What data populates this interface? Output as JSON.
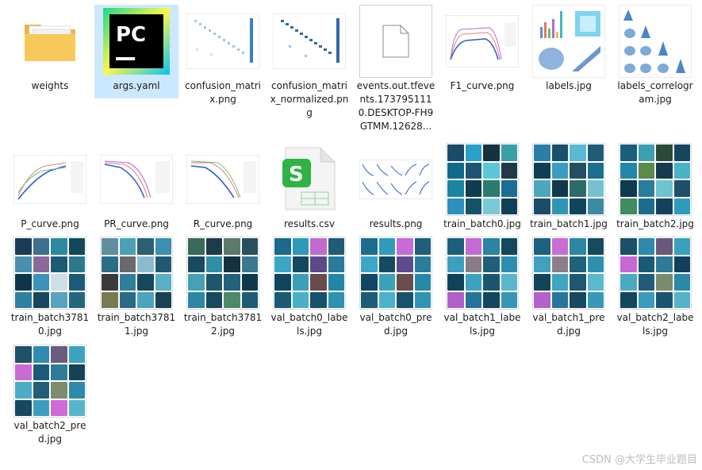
{
  "files": [
    {
      "name": "weights",
      "kind": "folder"
    },
    {
      "name": "args.yaml",
      "kind": "pycharm",
      "selected": true
    },
    {
      "name": "confusion_matrix.png",
      "kind": "matrix"
    },
    {
      "name": "confusion_matrix_normalized.png",
      "kind": "matrix"
    },
    {
      "name": "events.out.tfevents.1737951110.DESKTOP-FH9GTMM.12628...",
      "kind": "blank"
    },
    {
      "name": "F1_curve.png",
      "kind": "curve"
    },
    {
      "name": "labels.jpg",
      "kind": "labels"
    },
    {
      "name": "labels_correlogram.jpg",
      "kind": "correlogram"
    },
    {
      "name": "P_curve.png",
      "kind": "curve"
    },
    {
      "name": "PR_curve.png",
      "kind": "curve"
    },
    {
      "name": "R_curve.png",
      "kind": "curve"
    },
    {
      "name": "results.csv",
      "kind": "csv"
    },
    {
      "name": "results.png",
      "kind": "results"
    },
    {
      "name": "train_batch0.jpg",
      "kind": "mosaic"
    },
    {
      "name": "train_batch1.jpg",
      "kind": "mosaic"
    },
    {
      "name": "train_batch2.jpg",
      "kind": "mosaic"
    },
    {
      "name": "train_batch37810.jpg",
      "kind": "mosaic"
    },
    {
      "name": "train_batch37811.jpg",
      "kind": "mosaic"
    },
    {
      "name": "train_batch37812.jpg",
      "kind": "mosaic"
    },
    {
      "name": "val_batch0_labels.jpg",
      "kind": "mosaic"
    },
    {
      "name": "val_batch0_pred.jpg",
      "kind": "mosaic"
    },
    {
      "name": "val_batch1_labels.jpg",
      "kind": "mosaic"
    },
    {
      "name": "val_batch1_pred.jpg",
      "kind": "mosaic"
    },
    {
      "name": "val_batch2_labels.jpg",
      "kind": "mosaic"
    },
    {
      "name": "val_batch2_pred.jpg",
      "kind": "mosaic"
    }
  ],
  "watermark": "CSDN @大学生毕业题目",
  "colors": {
    "selection": "#cce8ff",
    "folder": "#f7c95c",
    "pycharm": "#21d789",
    "csv": "#2fb344"
  }
}
